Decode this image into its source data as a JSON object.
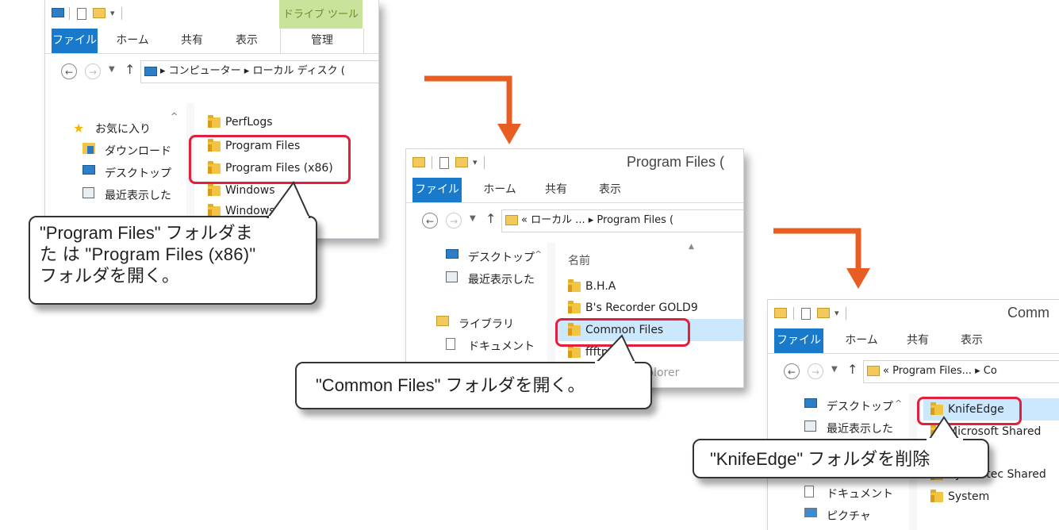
{
  "colors": {
    "accent": "#1979ca",
    "highlight": "#e0203c",
    "arrow": "#e85e22",
    "drive_tab": "#c9e39d"
  },
  "window1": {
    "drive_tools": "ドライブ ツール",
    "tabs": {
      "file": "ファイル",
      "home": "ホーム",
      "share": "共有",
      "view": "表示",
      "manage": "管理"
    },
    "path": "▸ コンピューター ▸ ローカル ディスク (",
    "nav": [
      "お気に入り",
      "ダウンロード",
      "デスクトップ",
      "最近表示した"
    ],
    "items": [
      "PerfLogs",
      "Program Files",
      "Program Files (x86)",
      "Windows",
      "Windows.old"
    ]
  },
  "callout1": {
    "line1": "\"Program Files\" フォルダま",
    "line2": "た は \"Program Files (x86)\"",
    "line3": "フォルダを開く。"
  },
  "window2": {
    "title": "Program Files (",
    "tabs": {
      "file": "ファイル",
      "home": "ホーム",
      "share": "共有",
      "view": "表示"
    },
    "path": "« ローカル ... ▸ Program Files (",
    "nav": [
      "デスクトップ",
      "最近表示した",
      "ライブラリ",
      "ドキュメント"
    ],
    "column_header": "名前",
    "items": [
      "B.H.A",
      "B's Recorder GOLD9",
      "Common Files",
      "ffftp",
      "Internet Explorer"
    ]
  },
  "callout2": {
    "text": "\"Common Files\" フォルダを開く。"
  },
  "window3": {
    "title": "Comm",
    "tabs": {
      "file": "ファイル",
      "home": "ホーム",
      "share": "共有",
      "view": "表示"
    },
    "path": "« Program Files... ▸ Co",
    "nav": [
      "デスクトップ",
      "最近表示した",
      "ドキュメント",
      "ピクチャ"
    ],
    "items": [
      "KnifeEdge",
      "Microsoft Shared",
      "Symantec Shared",
      "System"
    ]
  },
  "callout3": {
    "text": "\"KnifeEdge\" フォルダを削除"
  }
}
